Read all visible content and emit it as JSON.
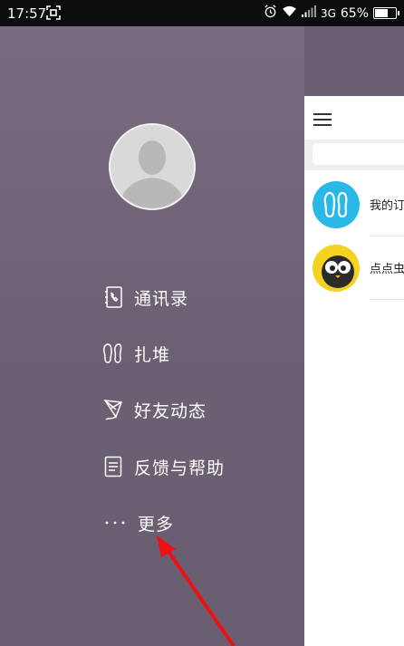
{
  "status_bar": {
    "time": "17:57",
    "network": "3G",
    "battery": "65%",
    "battery_level": 0.65
  },
  "drawer": {
    "menu": [
      {
        "label": "通讯录",
        "icon": "contacts-icon"
      },
      {
        "label": "扎堆",
        "icon": "footprints-icon"
      },
      {
        "label": "好友动态",
        "icon": "kite-icon"
      },
      {
        "label": "反馈与帮助",
        "icon": "document-icon"
      },
      {
        "label": "更多",
        "icon": "more-dots-icon"
      }
    ]
  },
  "conversations": [
    {
      "name": "我的订",
      "avatar_color": "#29b8e8"
    },
    {
      "name": "点点虫",
      "avatar_color": "#f5d21f"
    }
  ],
  "colors": {
    "drawer_bg": "#6c5f73",
    "status_bar_bg": "#0d0d0f",
    "annotation_arrow": "#ee1111"
  }
}
